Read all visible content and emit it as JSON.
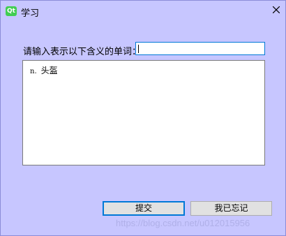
{
  "window": {
    "title": "学习",
    "logo_text": "Qt"
  },
  "form": {
    "prompt": "请输入表示以下含义的单词：",
    "input_value": "",
    "meaning_pos": "n.",
    "meaning_text": "头盔"
  },
  "buttons": {
    "submit": "提交",
    "forgot": "我已忘记"
  },
  "watermark": "https://blog.csdn.net/u012015956",
  "colors": {
    "background": "#c7c6ff",
    "focus_border": "#0078d7",
    "qt_green": "#41cd52",
    "button_face": "#e1e1e1"
  }
}
